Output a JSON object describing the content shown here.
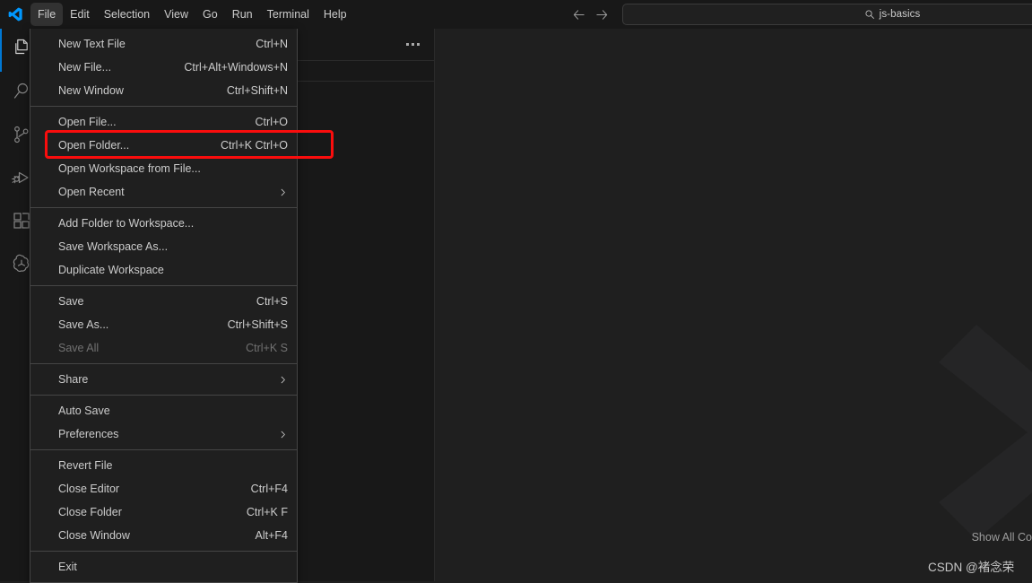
{
  "titlebar": {
    "logo_icon": "vscode-logo-icon",
    "menubar": [
      {
        "label": "File",
        "active": true
      },
      {
        "label": "Edit",
        "active": false
      },
      {
        "label": "Selection",
        "active": false
      },
      {
        "label": "View",
        "active": false
      },
      {
        "label": "Go",
        "active": false
      },
      {
        "label": "Run",
        "active": false
      },
      {
        "label": "Terminal",
        "active": false
      },
      {
        "label": "Help",
        "active": false
      }
    ],
    "nav_back_icon": "arrow-left-icon",
    "nav_forward_icon": "arrow-right-icon",
    "command_center": {
      "icon": "search-icon",
      "value": "js-basics"
    }
  },
  "activitybar": {
    "items": [
      {
        "name": "explorer",
        "icon": "files-icon",
        "active": true
      },
      {
        "name": "search",
        "icon": "search-icon",
        "active": false
      },
      {
        "name": "source-control",
        "icon": "source-control-icon",
        "active": false
      },
      {
        "name": "run-and-debug",
        "icon": "debug-icon",
        "active": false
      },
      {
        "name": "extensions",
        "icon": "extensions-icon",
        "active": false
      },
      {
        "name": "copilot-chat",
        "icon": "openai-icon",
        "active": false
      }
    ]
  },
  "sidebar": {
    "more_actions_icon": "ellipsis-icon"
  },
  "editor": {
    "watermark_icon": "vscode-chevron-watermark-icon",
    "hint_text": "Show All Co",
    "csdn_watermark": "CSDN @褚念荣"
  },
  "file_menu": {
    "groups": [
      {
        "items": [
          {
            "label": "New Text File",
            "keybind": "Ctrl+N",
            "submenu": false,
            "disabled": false
          },
          {
            "label": "New File...",
            "keybind": "Ctrl+Alt+Windows+N",
            "submenu": false,
            "disabled": false
          },
          {
            "label": "New Window",
            "keybind": "Ctrl+Shift+N",
            "submenu": false,
            "disabled": false
          }
        ]
      },
      {
        "items": [
          {
            "label": "Open File...",
            "keybind": "Ctrl+O",
            "submenu": false,
            "disabled": false
          },
          {
            "label": "Open Folder...",
            "keybind": "Ctrl+K Ctrl+O",
            "submenu": false,
            "disabled": false,
            "highlighted": true
          },
          {
            "label": "Open Workspace from File...",
            "keybind": "",
            "submenu": false,
            "disabled": false
          },
          {
            "label": "Open Recent",
            "keybind": "",
            "submenu": true,
            "disabled": false
          }
        ]
      },
      {
        "items": [
          {
            "label": "Add Folder to Workspace...",
            "keybind": "",
            "submenu": false,
            "disabled": false
          },
          {
            "label": "Save Workspace As...",
            "keybind": "",
            "submenu": false,
            "disabled": false
          },
          {
            "label": "Duplicate Workspace",
            "keybind": "",
            "submenu": false,
            "disabled": false
          }
        ]
      },
      {
        "items": [
          {
            "label": "Save",
            "keybind": "Ctrl+S",
            "submenu": false,
            "disabled": false
          },
          {
            "label": "Save As...",
            "keybind": "Ctrl+Shift+S",
            "submenu": false,
            "disabled": false
          },
          {
            "label": "Save All",
            "keybind": "Ctrl+K S",
            "submenu": false,
            "disabled": true
          }
        ]
      },
      {
        "items": [
          {
            "label": "Share",
            "keybind": "",
            "submenu": true,
            "disabled": false
          }
        ]
      },
      {
        "items": [
          {
            "label": "Auto Save",
            "keybind": "",
            "submenu": false,
            "disabled": false
          },
          {
            "label": "Preferences",
            "keybind": "",
            "submenu": true,
            "disabled": false
          }
        ]
      },
      {
        "items": [
          {
            "label": "Revert File",
            "keybind": "",
            "submenu": false,
            "disabled": false
          },
          {
            "label": "Close Editor",
            "keybind": "Ctrl+F4",
            "submenu": false,
            "disabled": false
          },
          {
            "label": "Close Folder",
            "keybind": "Ctrl+K F",
            "submenu": false,
            "disabled": false
          },
          {
            "label": "Close Window",
            "keybind": "Alt+F4",
            "submenu": false,
            "disabled": false
          }
        ]
      },
      {
        "items": [
          {
            "label": "Exit",
            "keybind": "",
            "submenu": false,
            "disabled": false
          }
        ]
      }
    ]
  },
  "colors": {
    "titlebar_bg": "#181818",
    "editor_bg": "#1f1f1f",
    "menu_bg": "#1f1f1f",
    "menu_border": "#454545",
    "accent": "#0078d4",
    "highlight_red": "#fa0d0d",
    "text": "#cccccc",
    "text_disabled": "#717171"
  }
}
